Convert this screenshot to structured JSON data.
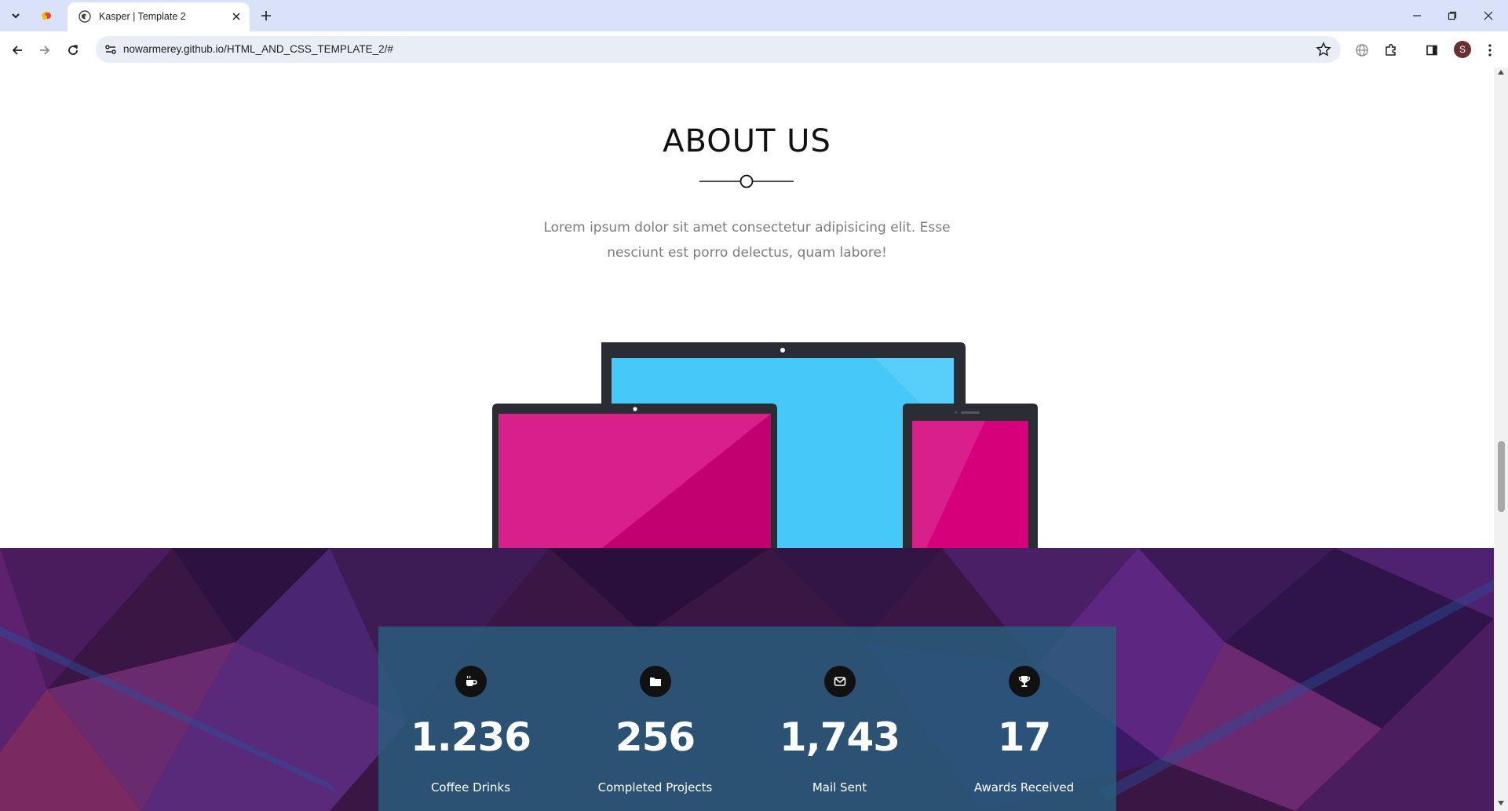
{
  "browser": {
    "tab_title": "Kasper | Template 2",
    "url": "nowarmerey.github.io/HTML_AND_CSS_TEMPLATE_2/#",
    "profile_initial": "S",
    "colors": {
      "tabbar": "#d9e2f8",
      "omnibox": "#e9eef6"
    }
  },
  "about": {
    "title": "ABOUT US",
    "text": "Lorem ipsum dolor sit amet consectetur adipisicing elit. Esse nesciunt est porro delectus, quam labore!"
  },
  "stats": [
    {
      "icon": "coffee-icon",
      "value": "1.236",
      "label": "Coffee Drinks"
    },
    {
      "icon": "folder-icon",
      "value": "256",
      "label": "Completed Projects"
    },
    {
      "icon": "envelope-icon",
      "value": "1,743",
      "label": "Mail Sent"
    },
    {
      "icon": "trophy-icon",
      "value": "17",
      "label": "Awards Received"
    }
  ],
  "colors": {
    "device_frame": "#2b2d35",
    "screen_blue": "#46c8f8",
    "screen_pink": "#d6007b",
    "stats_overlay": "#285f7d",
    "stats_bg": "#3a1645"
  }
}
